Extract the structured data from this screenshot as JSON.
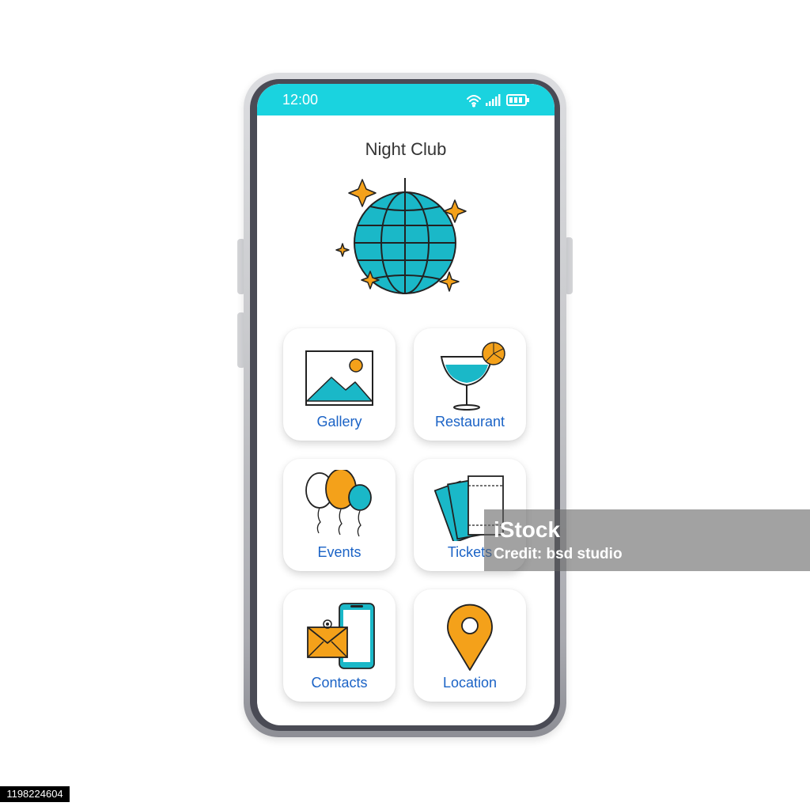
{
  "status_bar": {
    "time": "12:00",
    "color": "#1ad3df"
  },
  "page": {
    "title": "Night Club"
  },
  "hero": {
    "icon": "disco-ball-icon"
  },
  "menu": [
    {
      "label": "Gallery",
      "icon": "gallery-image-icon"
    },
    {
      "label": "Restaurant",
      "icon": "cocktail-glass-icon"
    },
    {
      "label": "Events",
      "icon": "balloons-icon"
    },
    {
      "label": "Tickets",
      "icon": "tickets-icon"
    },
    {
      "label": "Contacts",
      "icon": "phone-mail-icon"
    },
    {
      "label": "Location",
      "icon": "map-pin-icon"
    }
  ],
  "colors": {
    "accent": "#1ad3df",
    "label": "#1b63c6",
    "orange": "#f4a11a"
  },
  "watermark": {
    "logo": "iStock",
    "credit": "Credit: bsd studio"
  },
  "stock_id": "1198224604"
}
